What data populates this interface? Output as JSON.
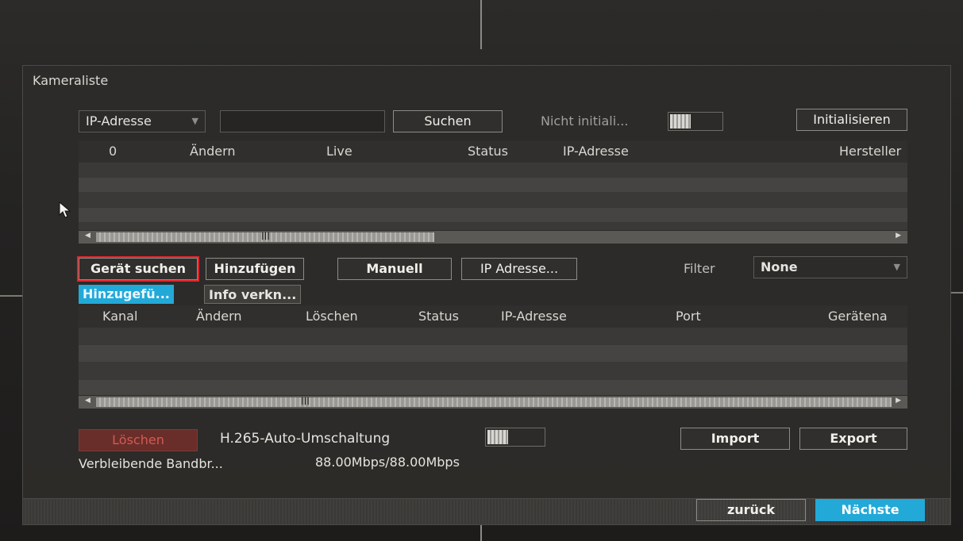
{
  "dialog": {
    "title": "Kameraliste"
  },
  "search_bar": {
    "search_type": "IP-Adresse",
    "search_button": "Suchen",
    "uninit_label": "Nicht initiali...",
    "initialize_button": "Initialisieren"
  },
  "device_table": {
    "headers": [
      "0",
      "Ändern",
      "Live",
      "Status",
      "IP-Adresse",
      "Hersteller"
    ],
    "rows": 5
  },
  "actions": {
    "search_device": "Gerät suchen",
    "add": "Hinzufügen",
    "manual": "Manuell",
    "ip_address": "IP Adresse...",
    "filter_label": "Filter",
    "filter_value": "None"
  },
  "tabs": [
    {
      "label": "Hinzugefü...",
      "active": true
    },
    {
      "label": "Info verkn...",
      "active": false
    }
  ],
  "added_table": {
    "headers": [
      "Kanal",
      "Ändern",
      "Löschen",
      "Status",
      "IP-Adresse",
      "Port",
      "Gerätena"
    ],
    "rows": 4
  },
  "bottom": {
    "delete_button": "Löschen",
    "h265_label": "H.265-Auto-Umschaltung",
    "import_button": "Import",
    "export_button": "Export",
    "bandwidth_label": "Verbleibende Bandbr...",
    "bandwidth_value": "88.00Mbps/88.00Mbps"
  },
  "footer": {
    "back_button": "zurück",
    "next_button": "Nächste"
  },
  "colors": {
    "accent": "#22a9d8",
    "highlight_border": "#e3242b",
    "danger_text": "#d15a52"
  },
  "icons": {
    "dropdown": "chevron-down-icon",
    "cursor": "mouse-pointer-icon",
    "scroll_left": "arrow-left-icon",
    "scroll_right": "arrow-right-icon"
  }
}
